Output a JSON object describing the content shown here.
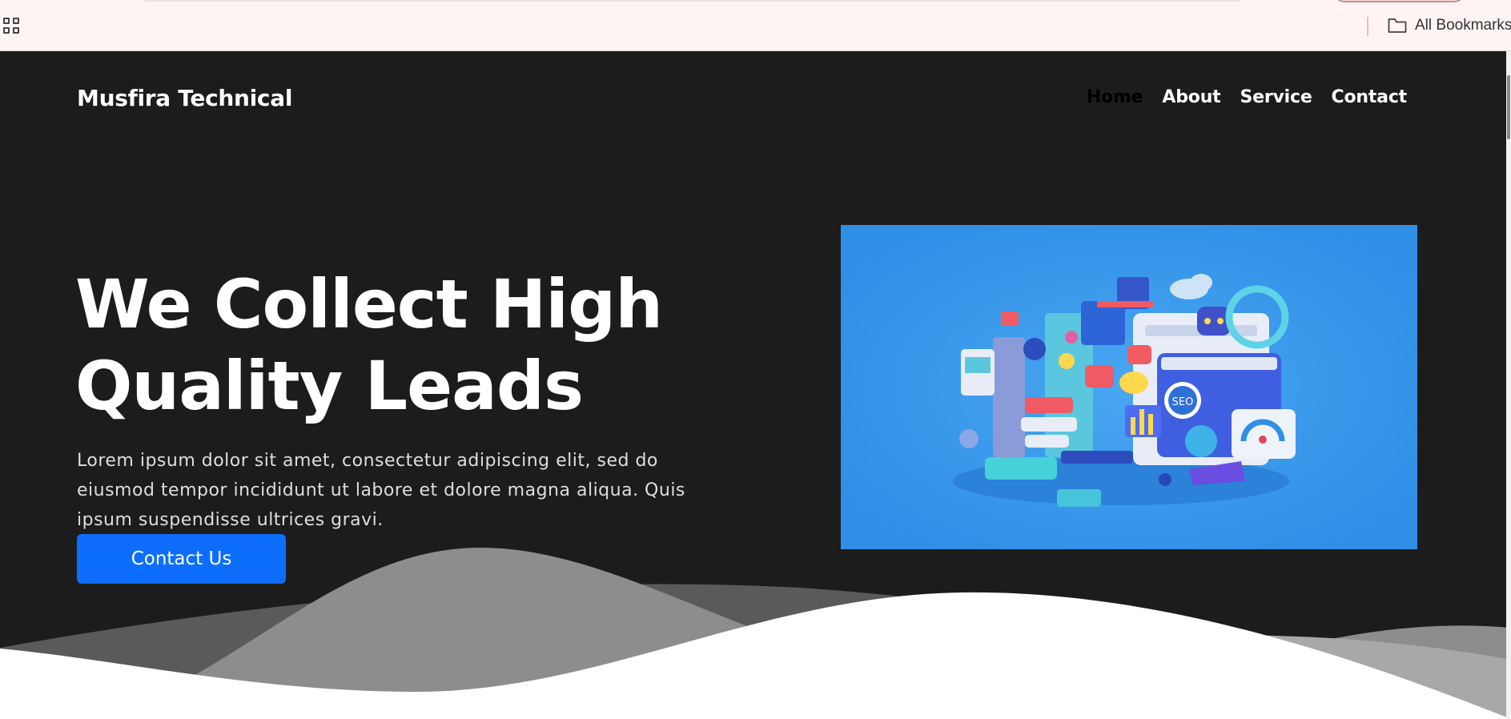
{
  "browser": {
    "bookmarks_bar": {
      "apps_icon": "apps-grid-icon",
      "all_bookmarks_label": "All Bookmarks",
      "folder_icon": "folder-icon"
    }
  },
  "site": {
    "brand": "Musfira Technical",
    "nav": [
      {
        "label": "Home",
        "active": true
      },
      {
        "label": "About",
        "active": false
      },
      {
        "label": "Service",
        "active": false
      },
      {
        "label": "Contact",
        "active": false
      }
    ],
    "hero": {
      "title": "We Collect High Quality Leads",
      "text": "Lorem ipsum dolor sit amet, consectetur adipiscing elit, sed do eiusmod tempor incididunt ut labore et dolore magna aliqua. Quis ipsum suspendisse ultrices gravi.",
      "cta_label": "Contact Us"
    }
  },
  "colors": {
    "background": "#1c1c1c",
    "primary_button": "#0d6efd",
    "hero_image_bg": "#3399ea"
  }
}
